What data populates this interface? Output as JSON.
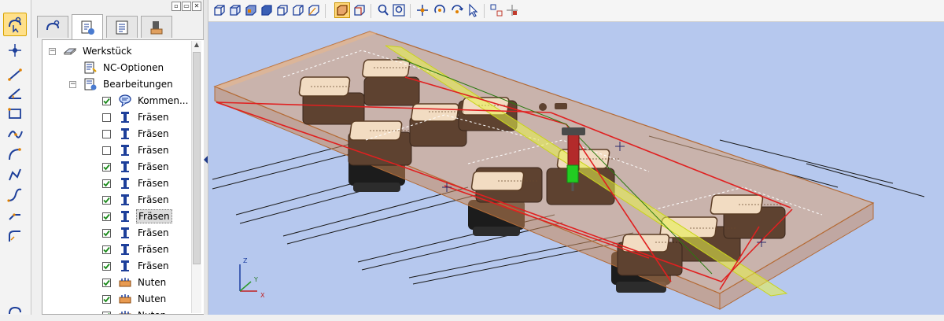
{
  "tree": {
    "items": [
      {
        "label": "Werkstück",
        "icon": "workpiece-icon",
        "level": 0,
        "expander": "minus",
        "checkbox": null
      },
      {
        "label": "NC-Optionen",
        "icon": "nc-options-icon",
        "level": 1,
        "expander": null,
        "checkbox": null
      },
      {
        "label": "Bearbeitungen",
        "icon": "operations-icon",
        "level": 1,
        "expander": "minus",
        "checkbox": null
      },
      {
        "label": "Kommen...",
        "icon": "comment-icon",
        "level": 2,
        "expander": null,
        "checkbox": true
      },
      {
        "label": "Fräsen",
        "icon": "milling-tool-icon",
        "level": 2,
        "expander": null,
        "checkbox": false
      },
      {
        "label": "Fräsen",
        "icon": "milling-tool-icon",
        "level": 2,
        "expander": null,
        "checkbox": false
      },
      {
        "label": "Fräsen",
        "icon": "milling-tool-icon",
        "level": 2,
        "expander": null,
        "checkbox": false
      },
      {
        "label": "Fräsen",
        "icon": "milling-tool-icon",
        "level": 2,
        "expander": null,
        "checkbox": true
      },
      {
        "label": "Fräsen",
        "icon": "milling-tool-icon",
        "level": 2,
        "expander": null,
        "checkbox": true
      },
      {
        "label": "Fräsen",
        "icon": "milling-tool-icon",
        "level": 2,
        "expander": null,
        "checkbox": true
      },
      {
        "label": "Fräsen",
        "icon": "milling-tool-icon",
        "level": 2,
        "expander": null,
        "checkbox": true,
        "selected": true
      },
      {
        "label": "Fräsen",
        "icon": "milling-tool-icon",
        "level": 2,
        "expander": null,
        "checkbox": true
      },
      {
        "label": "Fräsen",
        "icon": "milling-tool-icon",
        "level": 2,
        "expander": null,
        "checkbox": true
      },
      {
        "label": "Fräsen",
        "icon": "milling-tool-icon",
        "level": 2,
        "expander": null,
        "checkbox": true
      },
      {
        "label": "Nuten",
        "icon": "groove-icon",
        "level": 2,
        "expander": null,
        "checkbox": true
      },
      {
        "label": "Nuten",
        "icon": "groove-icon",
        "level": 2,
        "expander": null,
        "checkbox": true
      },
      {
        "label": "Nuten",
        "icon": "groove-icon",
        "level": 2,
        "expander": null,
        "checkbox": true
      }
    ]
  },
  "viewport": {
    "axes": {
      "x": "X",
      "y": "Y",
      "z": "Z"
    }
  },
  "colors": {
    "viewport_background": "#b6c8ee",
    "workpiece": "#d9a277",
    "toolpath": "#e02020",
    "highlight": "#ffd77a"
  }
}
